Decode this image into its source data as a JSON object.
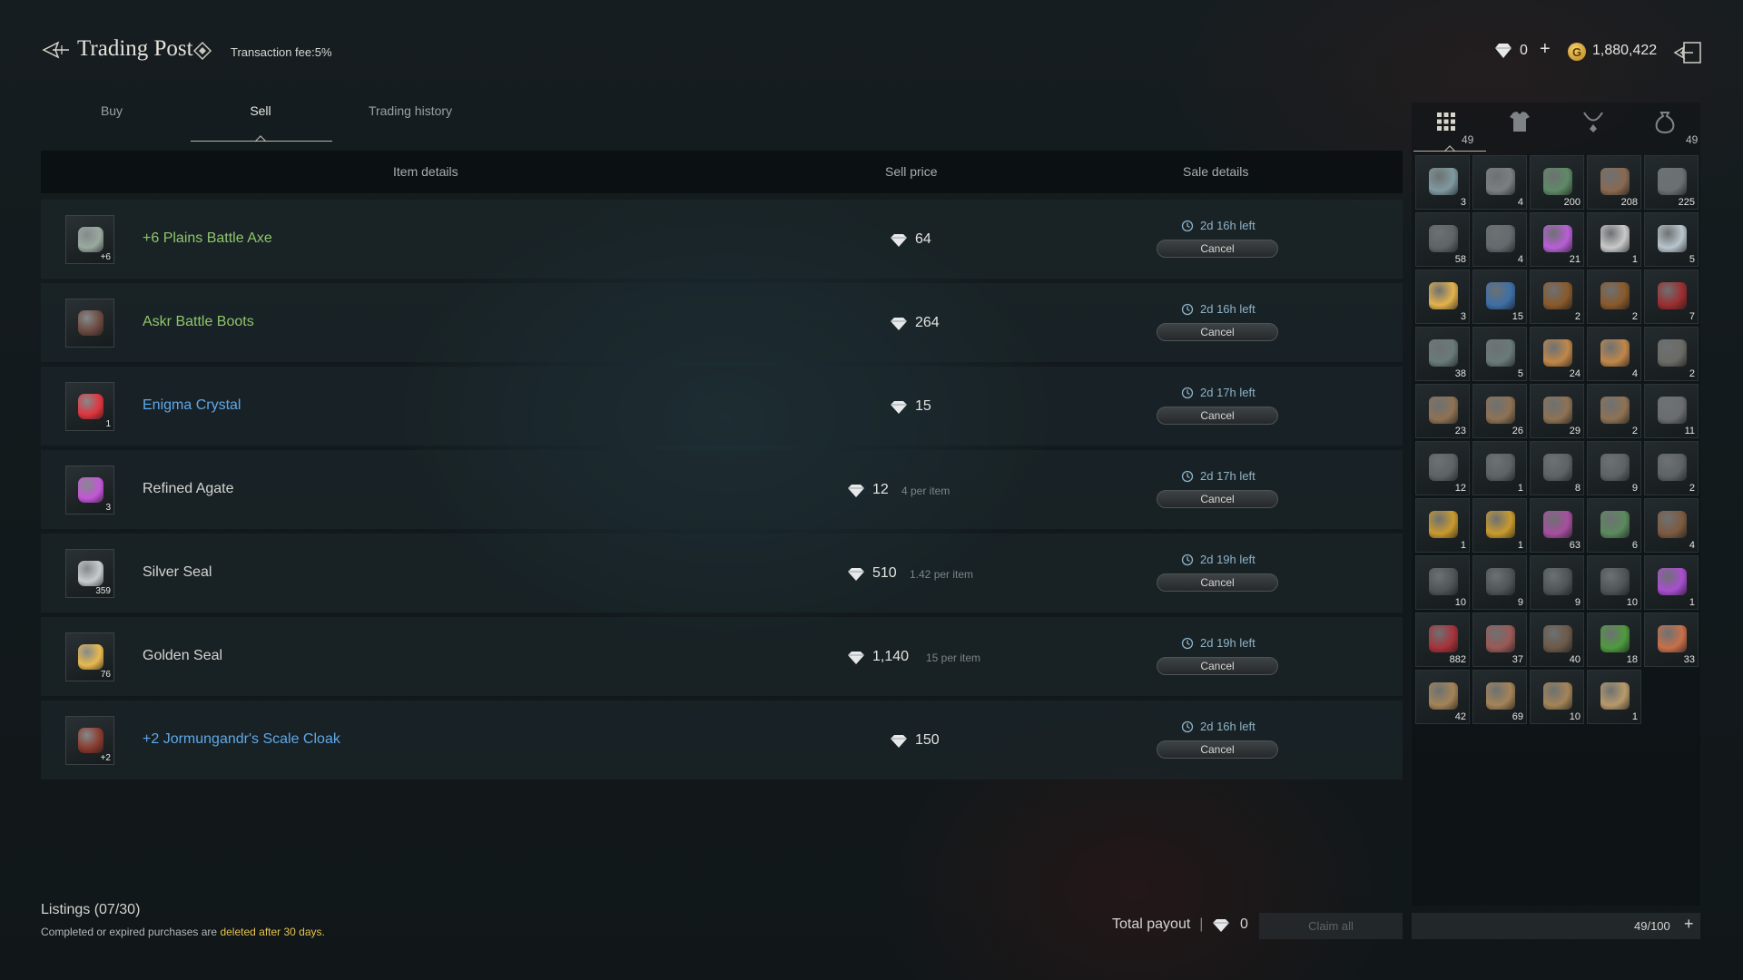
{
  "header": {
    "title": "Trading Post",
    "fee": "Transaction fee:5%",
    "premium_amount": "0",
    "premium_plus": "+",
    "gold_symbol": "G",
    "gold_amount": "1,880,422"
  },
  "tabs": [
    "Buy",
    "Sell",
    "Trading history"
  ],
  "active_tab": "Sell",
  "table": {
    "headers": [
      "Item details",
      "Sell price",
      "Sale details"
    ],
    "rows": [
      {
        "name": "+6 Plains Battle Axe",
        "badge": "+6",
        "price": "64",
        "per_item": "",
        "time_left": "2d 16h left",
        "action": "Cancel",
        "name_color": "#8fc56a",
        "icon": "axe-icon",
        "icon_color": "#9aa9a0"
      },
      {
        "name": "Askr Battle Boots",
        "badge": "",
        "price": "264",
        "per_item": "",
        "time_left": "2d 16h left",
        "action": "Cancel",
        "name_color": "#8fc56a",
        "icon": "boots-icon",
        "icon_color": "#6b4a40"
      },
      {
        "name": "Enigma Crystal",
        "badge": "1",
        "price": "15",
        "per_item": "",
        "time_left": "2d 17h left",
        "action": "Cancel",
        "name_color": "#5fa8e8",
        "icon": "crystal-icon",
        "icon_color": "#e0353f"
      },
      {
        "name": "Refined Agate",
        "badge": "3",
        "price": "12",
        "per_item": "4 per item",
        "time_left": "2d 17h left",
        "action": "Cancel",
        "name_color": "#d4d4d0",
        "icon": "agate-icon",
        "icon_color": "#c457d8"
      },
      {
        "name": "Silver Seal",
        "badge": "359",
        "price": "510",
        "per_item": "1.42 per item",
        "time_left": "2d 19h left",
        "action": "Cancel",
        "name_color": "#d4d4d0",
        "icon": "silver-seal-icon",
        "icon_color": "#c8ccd0"
      },
      {
        "name": "Golden Seal",
        "badge": "76",
        "price": "1,140",
        "per_item": "15 per item",
        "time_left": "2d 19h left",
        "action": "Cancel",
        "name_color": "#d4d4d0",
        "icon": "golden-seal-icon",
        "icon_color": "#e8b94e"
      },
      {
        "name": "+2 Jormungandr's Scale Cloak",
        "badge": "+2",
        "price": "150",
        "per_item": "",
        "time_left": "2d 16h left",
        "action": "Cancel",
        "name_color": "#5fa8e8",
        "icon": "cloak-icon",
        "icon_color": "#8a3a2e"
      }
    ]
  },
  "footer": {
    "listings": "Listings (07/30)",
    "note_prefix": "Completed or expired purchases are ",
    "note_highlight": "deleted after 30 days.",
    "total_payout_label": "Total payout",
    "payout_value": "0",
    "claim_all": "Claim all",
    "capacity": "49/100",
    "capacity_plus": "+"
  },
  "inventory": {
    "categories": [
      {
        "icon": "grid-icon",
        "count": "49"
      },
      {
        "icon": "armor-icon",
        "count": ""
      },
      {
        "icon": "necklace-icon",
        "count": ""
      },
      {
        "icon": "pouch-icon",
        "count": "49"
      }
    ],
    "items": [
      {
        "count": "3",
        "color": "#7f9aa0"
      },
      {
        "count": "4",
        "color": "#7b7f82"
      },
      {
        "count": "200",
        "color": "#5f8a66"
      },
      {
        "count": "208",
        "color": "#8a6a52"
      },
      {
        "count": "225",
        "color": "#6a7074"
      },
      {
        "count": "58",
        "color": "#5e6468"
      },
      {
        "count": "4",
        "color": "#646a6e"
      },
      {
        "count": "21",
        "color": "#b85fd6"
      },
      {
        "count": "1",
        "color": "#c9c9c9"
      },
      {
        "count": "5",
        "color": "#b9c5cc"
      },
      {
        "count": "3",
        "color": "#e3b24c"
      },
      {
        "count": "15",
        "color": "#3f6fa6"
      },
      {
        "count": "2",
        "color": "#8a5a2c"
      },
      {
        "count": "2",
        "color": "#8a5a2c"
      },
      {
        "count": "7",
        "color": "#9c2e30"
      },
      {
        "count": "38",
        "color": "#6a7a7a"
      },
      {
        "count": "5",
        "color": "#6a7a7a"
      },
      {
        "count": "24",
        "color": "#c0874a"
      },
      {
        "count": "4",
        "color": "#c0874a"
      },
      {
        "count": "2",
        "color": "#6b6b66"
      },
      {
        "count": "23",
        "color": "#8e7254"
      },
      {
        "count": "26",
        "color": "#8e7254"
      },
      {
        "count": "29",
        "color": "#8e7254"
      },
      {
        "count": "2",
        "color": "#8e7254"
      },
      {
        "count": "11",
        "color": "#6a6e70"
      },
      {
        "count": "12",
        "color": "#5d6366"
      },
      {
        "count": "1",
        "color": "#5d6366"
      },
      {
        "count": "8",
        "color": "#5d6366"
      },
      {
        "count": "9",
        "color": "#5d6366"
      },
      {
        "count": "2",
        "color": "#5d6366"
      },
      {
        "count": "1",
        "color": "#c99a2e"
      },
      {
        "count": "1",
        "color": "#c99a2e"
      },
      {
        "count": "63",
        "color": "#a74f9e"
      },
      {
        "count": "6",
        "color": "#5c8a5e"
      },
      {
        "count": "4",
        "color": "#7d5a40"
      },
      {
        "count": "10",
        "color": "#4f5558"
      },
      {
        "count": "9",
        "color": "#4f5558"
      },
      {
        "count": "9",
        "color": "#4f5558"
      },
      {
        "count": "10",
        "color": "#4f5558"
      },
      {
        "count": "1",
        "color": "#a84fcf"
      },
      {
        "count": "882",
        "color": "#a8323a"
      },
      {
        "count": "37",
        "color": "#9a5a56"
      },
      {
        "count": "40",
        "color": "#6c5a48"
      },
      {
        "count": "18",
        "color": "#4f9a3e"
      },
      {
        "count": "33",
        "color": "#c8704a"
      },
      {
        "count": "42",
        "color": "#a48458"
      },
      {
        "count": "69",
        "color": "#a48458"
      },
      {
        "count": "10",
        "color": "#a48458"
      },
      {
        "count": "1",
        "color": "#b89a6a"
      }
    ]
  },
  "colors": {
    "accent_blue": "#5fa8e8",
    "accent_green": "#8fc56a",
    "highlight_yellow": "#e5c24d"
  }
}
